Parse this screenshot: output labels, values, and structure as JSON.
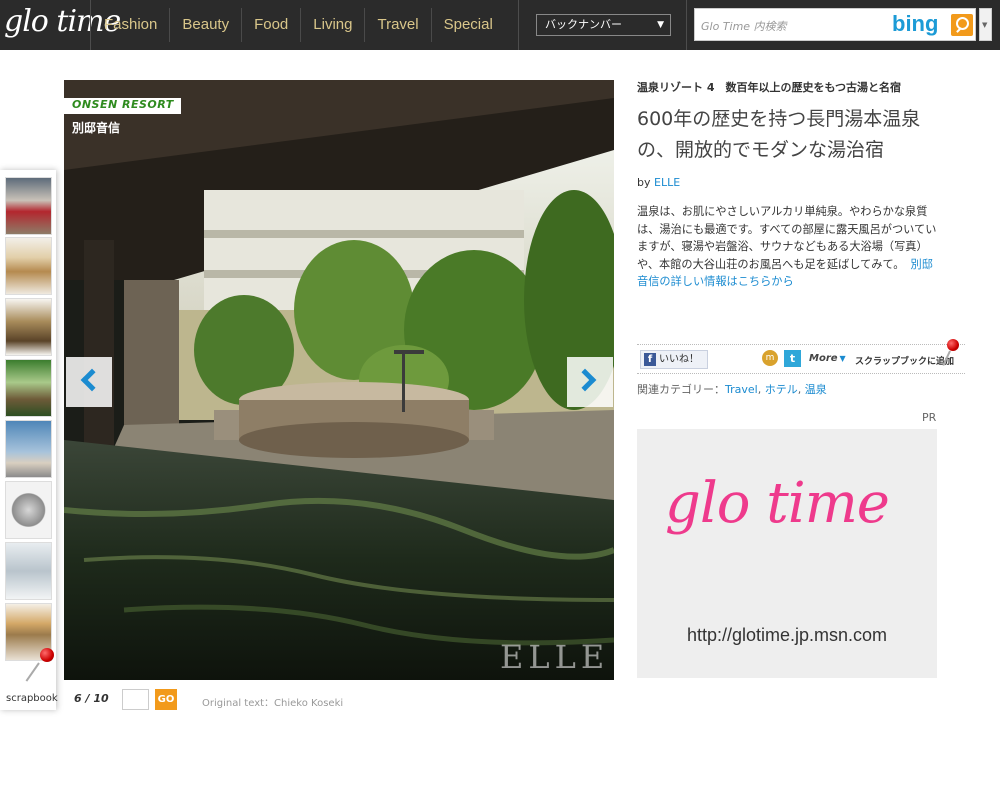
{
  "header": {
    "logo": "glo time",
    "nav": [
      "Fashion",
      "Beauty",
      "Food",
      "Living",
      "Travel",
      "Special"
    ],
    "backnumber": "バックナンバー",
    "search_placeholder": "Glo Time 内検索",
    "search_brand": "bing"
  },
  "scrapbook": {
    "label": "scrapbook"
  },
  "photo": {
    "badge": "ONSEN RESORT",
    "title": "別邸音信",
    "watermark": "ELLE",
    "page_current": 6,
    "page_total": 10,
    "pager_text": "6 / 10",
    "go_label": "GO",
    "credit": "Original text：Chieko Koseki"
  },
  "article": {
    "kicker": "温泉リゾート 4　数百年以上の歴史をもつ古湯と名宿",
    "headline": "600年の歴史を持つ長門湯本温泉の、開放的でモダンな湯治宿",
    "by_prefix": "by",
    "by_author": "ELLE",
    "body": "温泉は、お肌にやさしいアルカリ単純泉。やわらかな泉質は、湯治にも最適です。すべての部屋に露天風呂がついていますが、寝湯や岩盤浴、サウナなどもある大浴場（写真）や、本館の大谷山荘のお風呂へも足を延ばしてみて。",
    "body_link": "別邸音信の詳しい情報はこちらから",
    "share": {
      "facebook": "いいね！",
      "mixi": "m",
      "twitter": "t",
      "more": "More",
      "scrapbook_add": "スクラップブックに追加"
    },
    "categories_label": "関連カテゴリー：",
    "categories": [
      "Travel",
      "ホテル",
      "温泉"
    ]
  },
  "ad": {
    "pr_label": "PR",
    "logo": "glo time",
    "url": "http://glotime.jp.msn.com"
  },
  "colors": {
    "header_bg": "#2b2b2b",
    "nav_text": "#d9c68a",
    "link": "#1b8bd0",
    "accent_orange": "#f29a1b",
    "brand_pink": "#ee3a8c",
    "badge_green": "#2e8b1e"
  }
}
